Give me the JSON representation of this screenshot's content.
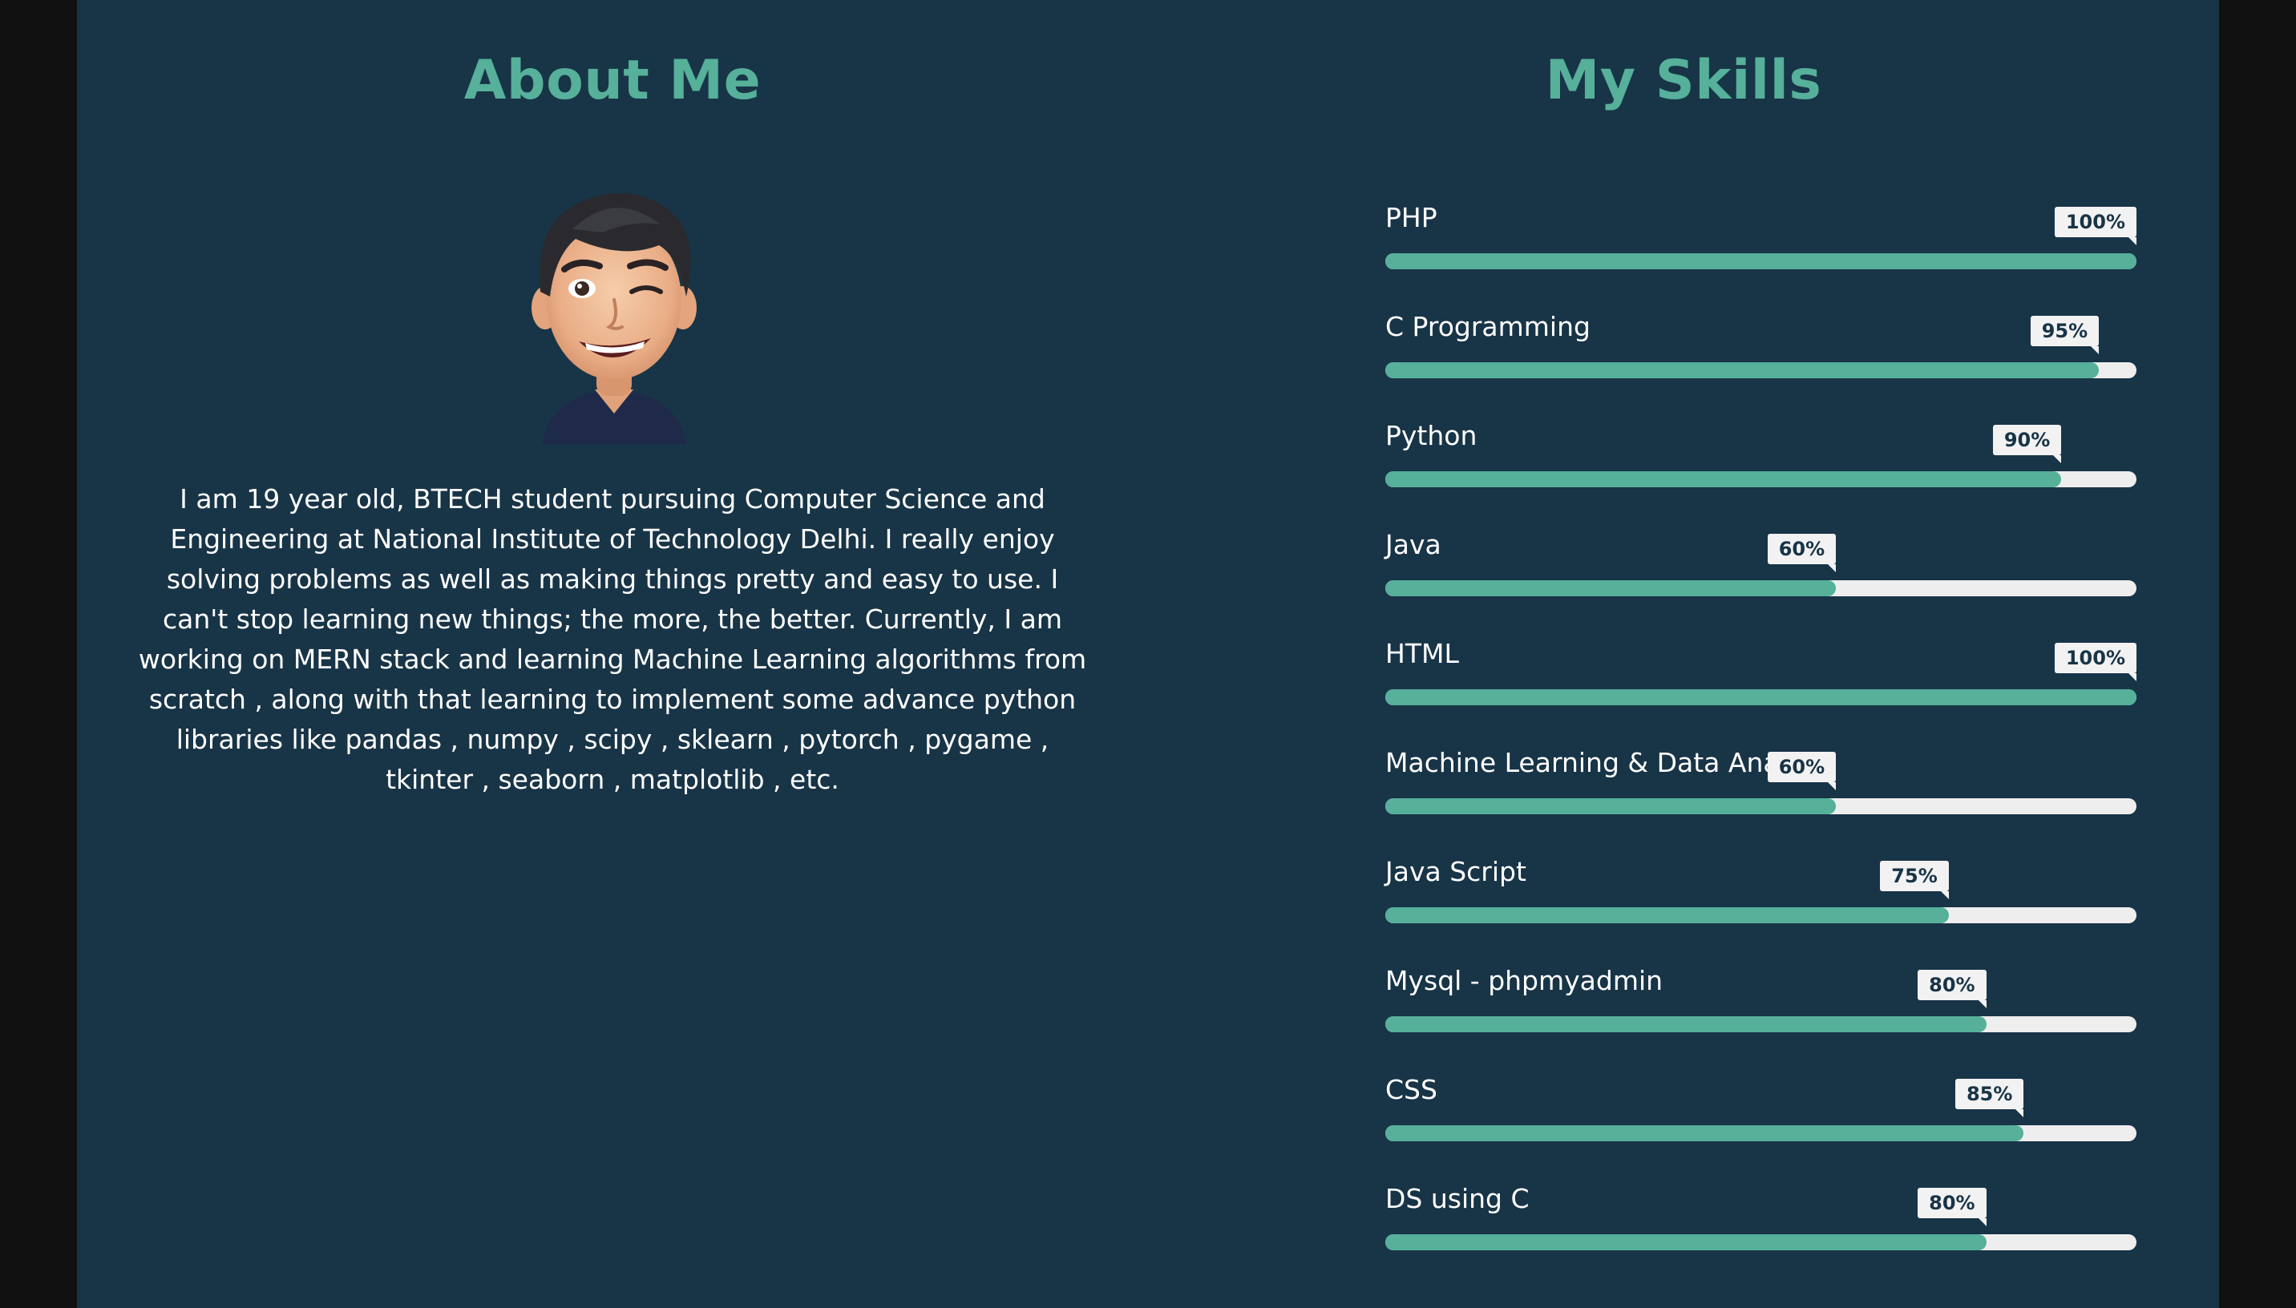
{
  "about": {
    "title": "About Me",
    "avatar_icon": "memoji-avatar-icon",
    "text": "I am 19 year old, BTECH student pursuing Computer Science and Engineering at National Institute of Technology Delhi. I really enjoy solving problems as well as making things pretty and easy to use. I can't stop learning new things; the more, the better. Currently, I am working on MERN stack and learning Machine Learning algorithms from scratch , along with that learning to implement some advance python libraries like pandas , numpy , scipy , sklearn , pytorch , pygame , tkinter , seaborn , matplotlib , etc."
  },
  "skills": {
    "title": "My Skills",
    "items": [
      {
        "name": "PHP",
        "label": "100%",
        "percent": 100
      },
      {
        "name": "C Programming",
        "label": "95%",
        "percent": 95
      },
      {
        "name": "Python",
        "label": "90%",
        "percent": 90
      },
      {
        "name": "Java",
        "label": "60%",
        "percent": 60
      },
      {
        "name": "HTML",
        "label": "100%",
        "percent": 100
      },
      {
        "name": "Machine Learning & Data Ana",
        "label": "60%",
        "percent": 60
      },
      {
        "name": "Java Script",
        "label": "75%",
        "percent": 75
      },
      {
        "name": "Mysql - phpmyadmin",
        "label": "80%",
        "percent": 80
      },
      {
        "name": "CSS",
        "label": "85%",
        "percent": 85
      },
      {
        "name": "DS using C",
        "label": "80%",
        "percent": 80
      }
    ]
  },
  "colors": {
    "page_background": "#183447",
    "outer_background": "#111111",
    "accent": "#56b09a",
    "bar_track": "#eeeeee",
    "badge_background": "#f2f2f2",
    "text": "#ffffff"
  }
}
